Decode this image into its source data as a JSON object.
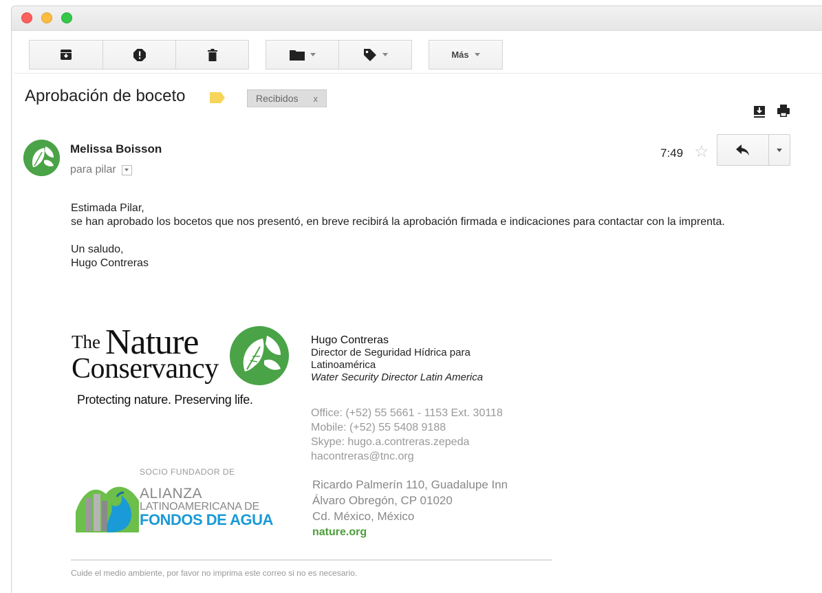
{
  "toolbar": {
    "archive": {
      "icon": "archive-icon"
    },
    "spam": {
      "icon": "report-spam-icon"
    },
    "delete": {
      "icon": "trash-icon"
    },
    "move": {
      "icon": "folder-icon"
    },
    "labels": {
      "icon": "label-icon"
    },
    "more_label": "Más"
  },
  "message": {
    "subject": "Aprobación de boceto",
    "label_color": "#f7d55b",
    "inbox_chip": "Recibidos",
    "inbox_chip_remove": "x",
    "sender": "Melissa Boisson",
    "recipient": "para pilar",
    "time": "7:49",
    "star": "☆"
  },
  "body": {
    "greeting": "Estimada Pilar,",
    "line1": "se han aprobado los bocetos que nos presentó, en breve recibirá la aprobación firmada e indicaciones para contactar con la imprenta.",
    "closing": "Un saludo,",
    "signoff": "Hugo Contreras"
  },
  "logo": {
    "the": "The",
    "nature": "Nature",
    "conservancy": "Conservancy",
    "tagline": "Protecting nature. Preserving life.",
    "green": "#4aa347"
  },
  "alianza": {
    "socio": "SOCIO FUNDADOR DE",
    "alianza": "ALIANZA",
    "latino": "LATINOAMERICANA DE",
    "fondos": "FONDOS DE AGUA"
  },
  "signature": {
    "name": "Hugo Contreras",
    "role_line1": "Director de Seguridad Hídrica para",
    "role_line2": "Latinoamérica",
    "role_en": "Water Security Director Latin America",
    "office": "Office: (+52) 55 5661 - 1153 Ext. 30118",
    "mobile": "Mobile: (+52) 55 5408 9188",
    "skype": "Skype: hugo.a.contreras.zepeda",
    "email": "hacontreras@tnc.org",
    "address1": "Ricardo Palmerín 110, Guadalupe Inn",
    "address2": "Álvaro Obregón, CP 01020",
    "address3": "Cd. México, México",
    "site": "nature.org"
  },
  "footer": {
    "note": "Cuide el medio ambiente, por favor no imprima este correo si no es necesario."
  }
}
